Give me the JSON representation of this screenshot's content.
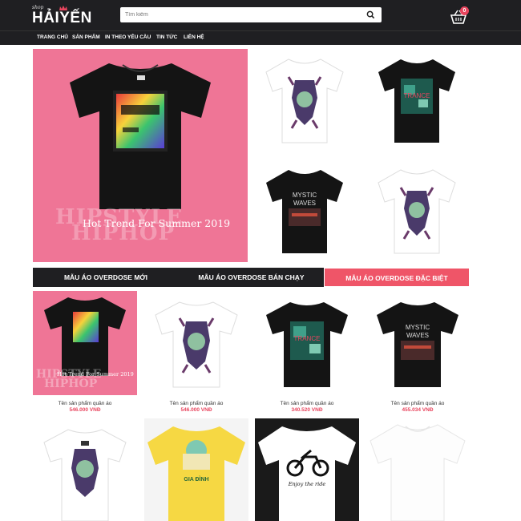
{
  "header": {
    "logo_small": "shop",
    "logo_big": "HẢIYẾN",
    "search_placeholder": "Tìm kiếm",
    "cart_count": "0"
  },
  "nav": {
    "items": [
      "TRANG CHỦ",
      "SẢN PHẨM",
      "IN THEO YÊU CẦU",
      "TIN TỨC",
      "LIÊN HỆ"
    ]
  },
  "hero": {
    "watermark_top": "HIPSTYLE",
    "watermark_bottom": "HIPHOP",
    "caption": "Hot Trend For Summer 2019"
  },
  "tabs": [
    "MẪU ÁO OVERDOSE MỚI",
    "MẪU ÁO OVERDOSE BÁN CHẠY",
    "MẪU ÁO OVERDOSE ĐẶC BIỆT"
  ],
  "products": [
    {
      "name": "Tên sản phẩm quần áo",
      "price": "546.000 VNĐ"
    },
    {
      "name": "Tên sản phẩm quần áo",
      "price": "546.000 VNĐ"
    },
    {
      "name": "Tên sản phẩm quần áo",
      "price": "340.520 VNĐ"
    },
    {
      "name": "Tên sản phẩm quần áo",
      "price": "455.034 VNĐ"
    }
  ],
  "product_card_one": {
    "watermark_top": "HIPSTYLE",
    "watermark_bottom": "HIPHOP",
    "caption": "Hot Trend For Summer 2019"
  },
  "shirt_prints": {
    "trance": "TRANCE",
    "mystic": "MYSTIC",
    "waves": "WAVES",
    "gia_dinh": "GIA ĐÌNH",
    "ride": "Enjoy the ride"
  },
  "colors": {
    "dark": "#1f1f22",
    "accent": "#ef5568",
    "pink_bg": "#ef7596",
    "price": "#e8455e"
  }
}
